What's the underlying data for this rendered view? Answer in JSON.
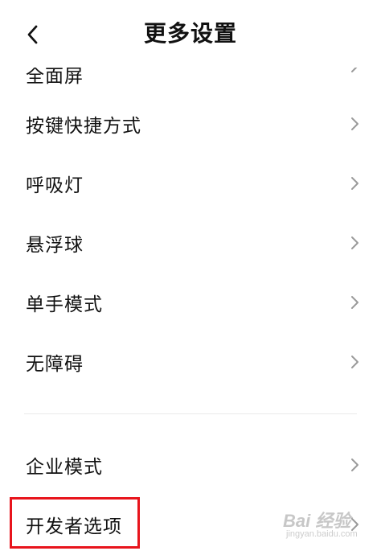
{
  "header": {
    "title": "更多设置"
  },
  "rows": [
    {
      "label": "全面屏"
    },
    {
      "label": "按键快捷方式"
    },
    {
      "label": "呼吸灯"
    },
    {
      "label": "悬浮球"
    },
    {
      "label": "单手模式"
    },
    {
      "label": "无障碍"
    },
    {
      "label": "企业模式"
    },
    {
      "label": "开发者选项"
    }
  ],
  "watermark": {
    "text": "Bai 经验",
    "sub": "jingyan.baidu.com"
  },
  "colors": {
    "highlight": "#e8141c",
    "chevron": "#9a9a9a",
    "text": "#111111"
  },
  "icons": {
    "back": "chevron-left-icon",
    "row": "chevron-right-icon"
  }
}
